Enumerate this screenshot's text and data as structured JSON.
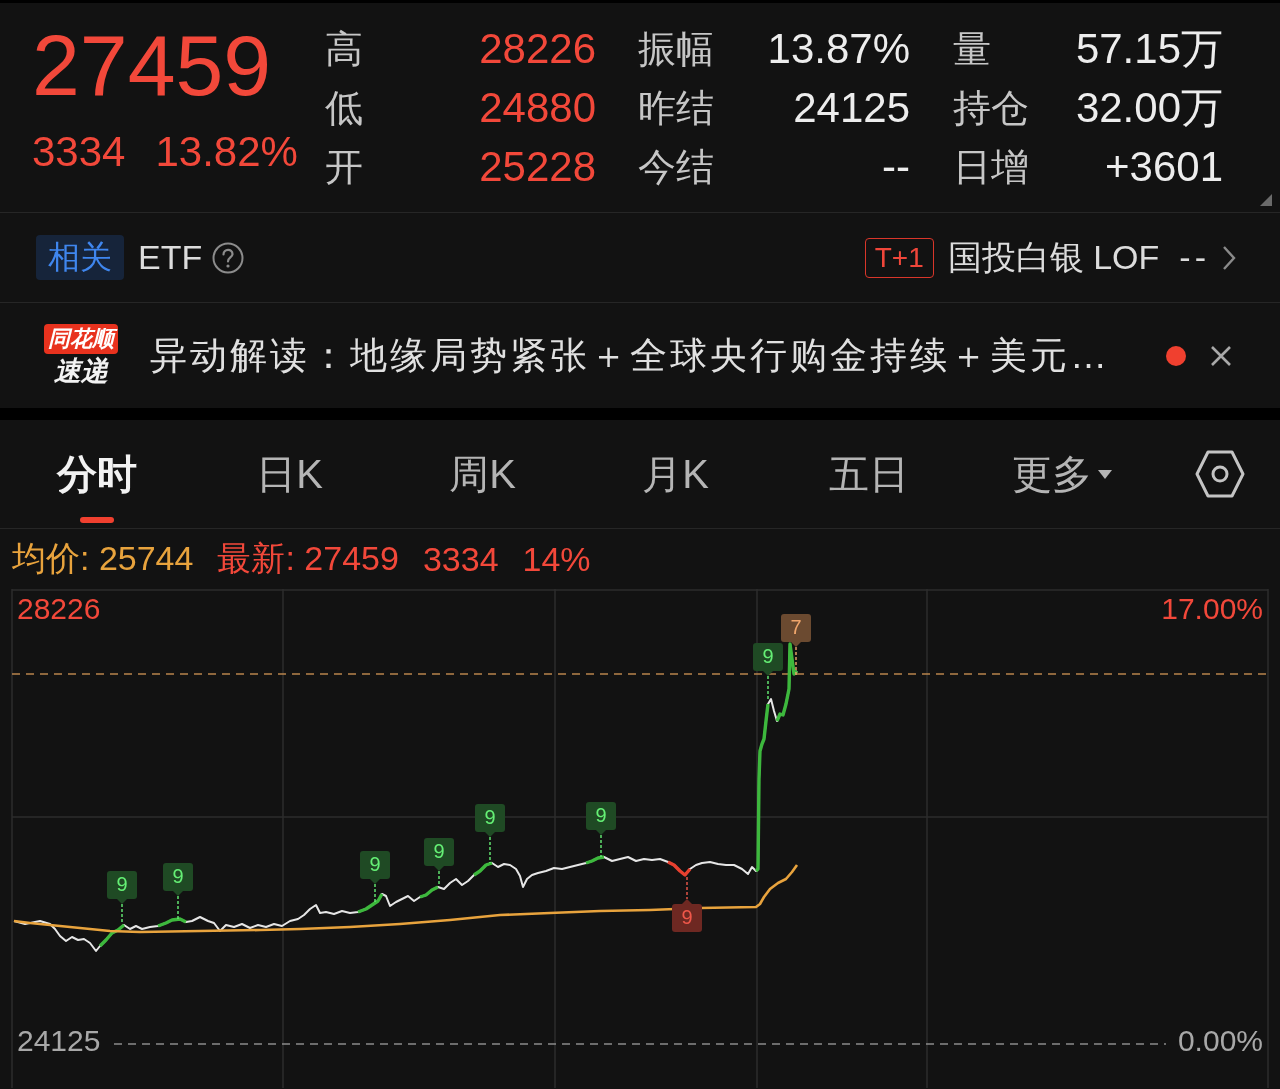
{
  "quote": {
    "price": "27459",
    "change": "3334",
    "percent": "13.82%"
  },
  "stats": [
    {
      "label": "高",
      "value": "28226",
      "color": "#f2483a"
    },
    {
      "label": "振幅",
      "value": "13.87%",
      "color": "#ededed"
    },
    {
      "label": "量",
      "value": "57.15万",
      "color": "#ededed"
    },
    {
      "label": "低",
      "value": "24880",
      "color": "#f2483a"
    },
    {
      "label": "昨结",
      "value": "24125",
      "color": "#ededed"
    },
    {
      "label": "持仓",
      "value": "32.00万",
      "color": "#ededed"
    },
    {
      "label": "开",
      "value": "25228",
      "color": "#f2483a"
    },
    {
      "label": "今结",
      "value": "--",
      "color": "#ededed"
    },
    {
      "label": "日增",
      "value": "+3601",
      "color": "#ededed"
    }
  ],
  "related": {
    "badge": "相关",
    "label": "ETF",
    "tag": "T+1",
    "fund": "国投白银 LOF",
    "price": "--"
  },
  "news": {
    "source_top": "同花顺",
    "source_bottom": "速递",
    "text": "异动解读：地缘局势紧张＋全球央行购金持续＋美元…",
    "unread": true
  },
  "tabs": [
    {
      "label": "分时",
      "selected": true,
      "kind": "tab"
    },
    {
      "label": "日K",
      "selected": false,
      "kind": "tab"
    },
    {
      "label": "周K",
      "selected": false,
      "kind": "tab"
    },
    {
      "label": "月K",
      "selected": false,
      "kind": "tab"
    },
    {
      "label": "五日",
      "selected": false,
      "kind": "tab"
    },
    {
      "label": "更多",
      "selected": false,
      "kind": "dropdown"
    }
  ],
  "legend": {
    "average": "均价: 25744",
    "latest": "最新: 27459",
    "change": "3334",
    "percent": "14%"
  },
  "chart": {
    "top_price": "28226",
    "top_percent": "17.00%",
    "base_price": "24125",
    "base_percent": "0.00%",
    "markers": [
      {
        "label": "9",
        "color": "#1f4a24"
      },
      {
        "label": "9",
        "color": "#1f4a24"
      },
      {
        "label": "9",
        "color": "#1f4a24"
      },
      {
        "label": "9",
        "color": "#1f4a24"
      },
      {
        "label": "9",
        "color": "#1f4a24"
      },
      {
        "label": "9",
        "color": "#1f4a24"
      },
      {
        "label": "9",
        "color": "#6e2822"
      },
      {
        "label": "9",
        "color": "#1f4a24"
      },
      {
        "label": "7",
        "color": "#6b4a30"
      }
    ]
  }
}
